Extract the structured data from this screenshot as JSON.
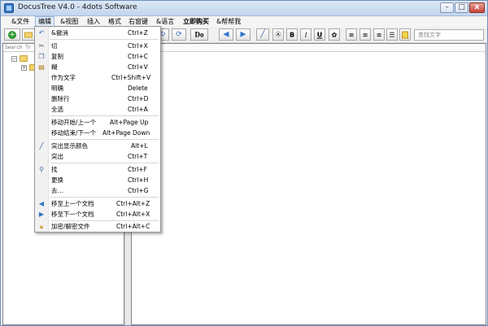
{
  "window": {
    "title": "DocusTree V4.0 - 4dots Software",
    "min_glyph": "–",
    "max_glyph": "□",
    "close_glyph": "x"
  },
  "menu": {
    "items": [
      "&文件",
      "编辑",
      "&视图",
      "插入",
      "格式",
      "右窗键",
      "&语言",
      "立即购买",
      "&帮帮我"
    ],
    "active": "编辑"
  },
  "toolbar": {
    "do_label": "Do",
    "search_placeholder": "查找文字",
    "buttons": {
      "b1": "B",
      "b2": "I",
      "b3": "U"
    }
  },
  "left_panel": {
    "search_label": "Search Tr"
  },
  "dropdown": {
    "items": [
      {
        "label": "&撤消",
        "shortcut": "Ctrl+Z",
        "icon": "undo-icon"
      },
      {
        "label": "切",
        "shortcut": "Ctrl+X",
        "icon": "cut-icon"
      },
      {
        "label": "复制",
        "shortcut": "Ctrl+C",
        "icon": "copy-icon"
      },
      {
        "label": "糊",
        "shortcut": "Ctrl+V",
        "icon": "paste-icon"
      },
      {
        "label": "作为文字",
        "shortcut": "Ctrl+Shift+V",
        "icon": ""
      },
      {
        "label": "明确",
        "shortcut": "Delete",
        "icon": ""
      },
      {
        "label": "删除行",
        "shortcut": "Ctrl+D",
        "icon": ""
      },
      {
        "label": "全选",
        "shortcut": "Ctrl+A",
        "icon": ""
      },
      {
        "label": "移动开始/上一个",
        "shortcut": "Alt+Page Up",
        "icon": ""
      },
      {
        "label": "移动结束/下一个",
        "shortcut": "Alt+Page Down",
        "icon": ""
      },
      {
        "label": "突出显示颜色",
        "shortcut": "Alt+L",
        "icon": "highlight-pen-icon"
      },
      {
        "label": "突出",
        "shortcut": "Ctrl+T",
        "icon": ""
      },
      {
        "label": "找",
        "shortcut": "Ctrl+F",
        "icon": "find-icon"
      },
      {
        "label": "更换",
        "shortcut": "Ctrl+H",
        "icon": ""
      },
      {
        "label": "去...",
        "shortcut": "Ctrl+G",
        "icon": ""
      },
      {
        "label": "移至上一个文档",
        "shortcut": "Ctrl+Alt+Z",
        "icon": "arrow-left-icon"
      },
      {
        "label": "移至下一个文档",
        "shortcut": "Ctrl+Alt+X",
        "icon": "arrow-right-icon"
      },
      {
        "label": "加密/解密文件",
        "shortcut": "Ctrl+Alt+C",
        "icon": "lock-icon"
      }
    ]
  }
}
